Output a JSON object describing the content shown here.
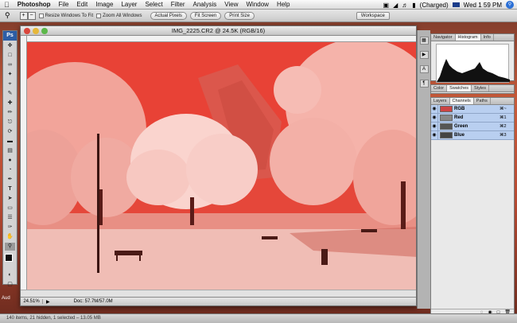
{
  "menubar": {
    "app": "Photoshop",
    "items": [
      "File",
      "Edit",
      "Image",
      "Layer",
      "Select",
      "Filter",
      "Analysis",
      "View",
      "Window",
      "Help"
    ],
    "battery": "(Charged)",
    "clock": "Wed 1 59 PM"
  },
  "options_bar": {
    "resize_windows_label": "Resize Windows To Fit",
    "zoom_all_label": "Zoom All Windows",
    "actual_pixels": "Actual Pixels",
    "fit_screen": "Fit Screen",
    "print_size": "Print Size",
    "workspace": "Workspace"
  },
  "toolbox": {
    "badge": "Ps"
  },
  "document": {
    "title": "IMG_2225.CR2 @ 24.5K (RGB/16)",
    "zoom": "24.51%",
    "doc_info": "Doc: 57.7M/57.0M"
  },
  "palettes": {
    "top_tabs": [
      "Navigator",
      "Histogram",
      "Info"
    ],
    "mid_tabs": [
      "Color",
      "Swatches",
      "Styles"
    ],
    "bottom_tabs": [
      "Layers",
      "Channels",
      "Paths"
    ],
    "channels": [
      {
        "name": "RGB",
        "shortcut": "⌘~"
      },
      {
        "name": "Red",
        "shortcut": "⌘1"
      },
      {
        "name": "Green",
        "shortcut": "⌘2"
      },
      {
        "name": "Blue",
        "shortcut": "⌘3"
      }
    ]
  },
  "finder_status": "140 items, 21 hidden, 1 selected – 13.05 MB",
  "desktop_partial_text": "Aud",
  "colors": {
    "canvas_red": "#e8493a",
    "channel_highlight": "#b9cff0",
    "ps_badge": "#2d5ea6"
  }
}
